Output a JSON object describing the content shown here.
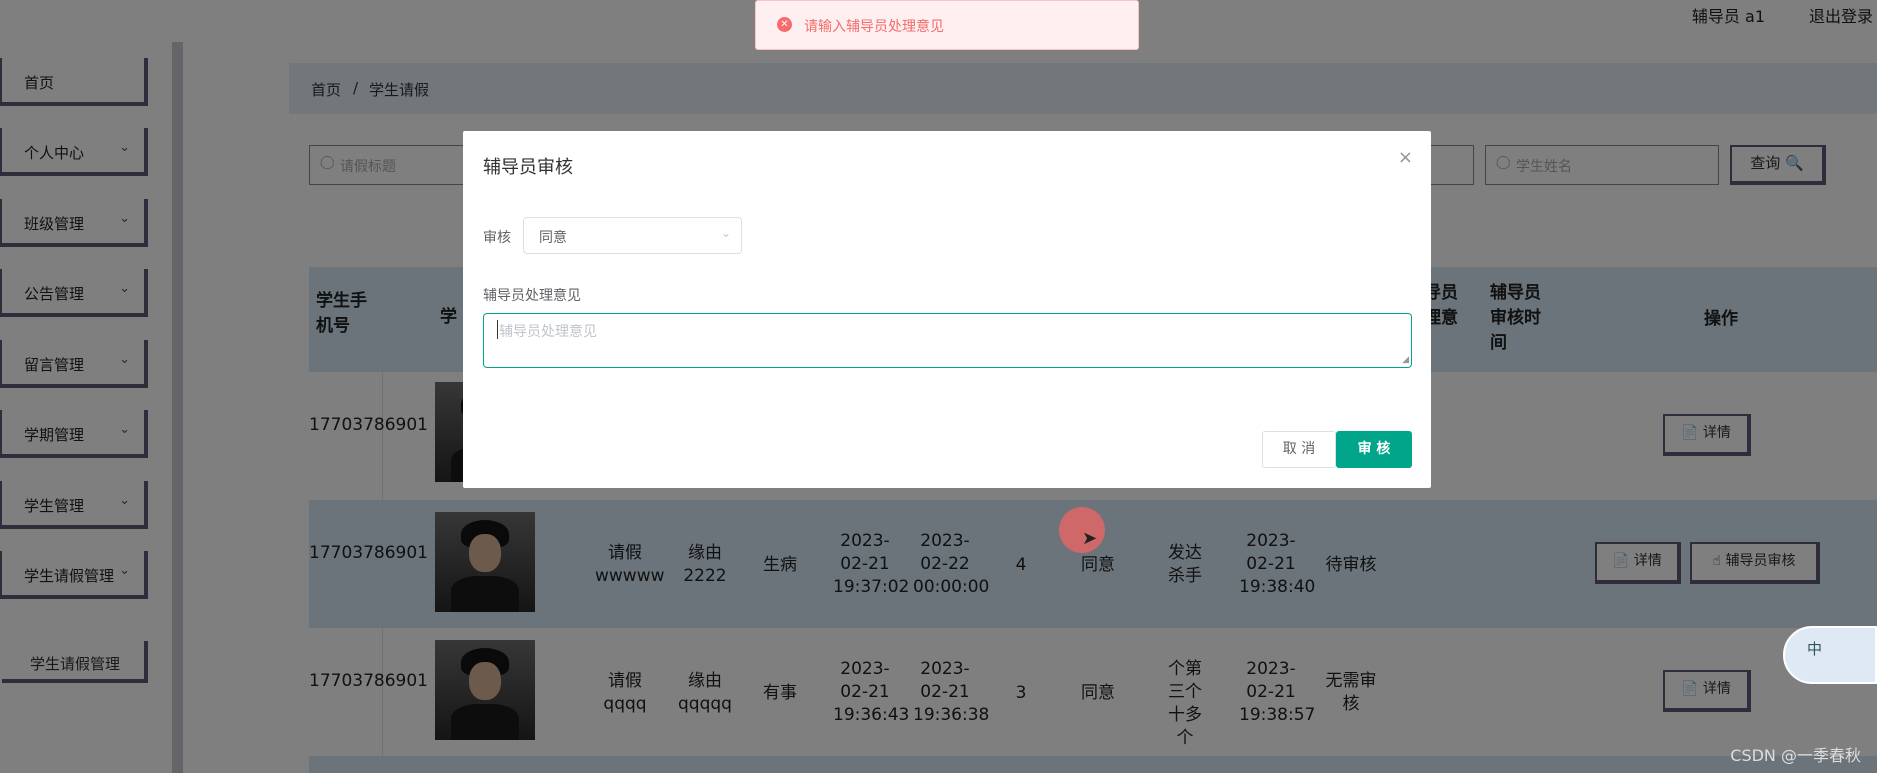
{
  "topbar": {
    "user": "辅导员 a1",
    "logout": "退出登录"
  },
  "sidebar": {
    "items": [
      {
        "label": "首页",
        "chevron": ""
      },
      {
        "label": "个人中心",
        "chevron": "⌄"
      },
      {
        "label": "班级管理",
        "chevron": "⌄"
      },
      {
        "label": "公告管理",
        "chevron": "⌄"
      },
      {
        "label": "留言管理",
        "chevron": "⌄"
      },
      {
        "label": "学期管理",
        "chevron": "⌄"
      },
      {
        "label": "学生管理",
        "chevron": "⌄"
      },
      {
        "label": "学生请假管理",
        "chevron": "⌄"
      }
    ],
    "sub_item": "学生请假管理"
  },
  "breadcrumb": {
    "home": "首页",
    "sep": "/",
    "current": "学生请假"
  },
  "search": {
    "title_placeholder": "请假标题",
    "name_placeholder": "学生姓名",
    "query_label": "查询 🔍"
  },
  "table": {
    "headers": {
      "phone": "学生手机号",
      "photo": "学",
      "opinion": "导员理意",
      "audit_time": "辅导员审核时间",
      "actions": "操作"
    },
    "rows": [
      {
        "phone": "17703786901",
        "title": "",
        "reason": "",
        "type": "",
        "start": "",
        "end": "",
        "days": "",
        "status": "",
        "remark": "",
        "time": "",
        "audit": "",
        "actions": [
          "📄 详情"
        ]
      },
      {
        "phone": "17703786901",
        "title": "请假wwwww",
        "reason": "缘由2222",
        "type": "生病",
        "start": "2023-02-21 19:37:02",
        "end": "2023-02-22 00:00:00",
        "days": "4",
        "status": "同意",
        "remark": "发达杀手",
        "time": "2023-02-21 19:38:40",
        "audit": "待审核",
        "actions": [
          "📄 详情",
          "☝ 辅导员审核"
        ]
      },
      {
        "phone": "17703786901",
        "title": "请假qqqq",
        "reason": "缘由qqqqq",
        "type": "有事",
        "start": "2023-02-21 19:36:43",
        "end": "2023-02-21 19:36:38",
        "days": "3",
        "status": "同意",
        "remark": "个第三个十多个",
        "time": "2023-02-21 19:38:57",
        "audit": "无需审核",
        "actions": [
          "📄 详情"
        ]
      }
    ]
  },
  "toast": {
    "icon": "✕",
    "message": "请输入辅导员处理意见",
    "color": "#f56c6c"
  },
  "dialog": {
    "title": "辅导员审核",
    "close_icon": "×",
    "audit_label": "审核",
    "audit_value": "同意",
    "opinion_label": "辅导员处理意见",
    "opinion_placeholder": "辅导员处理意见",
    "cancel_label": "取 消",
    "approve_label": "审 核",
    "accent": "#00a58a"
  },
  "ime": {
    "label": "中"
  },
  "watermark": "CSDN @一季春秋"
}
